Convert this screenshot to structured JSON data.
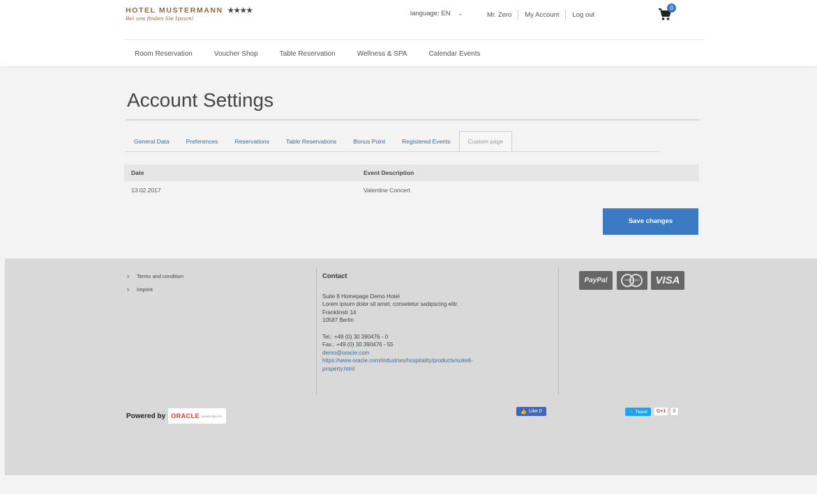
{
  "header": {
    "hotel_name": "HOTEL MUSTERMANN",
    "stars": "★★★★",
    "tagline": "Bei uns finden Sie Ipsum!",
    "language": "language: EN",
    "user_name": "Mr. Zero",
    "my_account": "My Account",
    "logout": "Log out",
    "cart_count": "0"
  },
  "nav": {
    "items": [
      "Room Reservation",
      "Voucher Shop",
      "Table Reservation",
      "Wellness & SPA",
      "Calendar Events"
    ]
  },
  "page": {
    "title": "Account Settings",
    "tabs": [
      "General Data",
      "Preferences",
      "Reservations",
      "Table Reservations",
      "Bonus Point",
      "Registered Events",
      "Custom page"
    ],
    "active_tab": "Custom page"
  },
  "table": {
    "headers": [
      "Date",
      "Event Description"
    ],
    "rows": [
      [
        "13.02.2017",
        "Valentine Concert"
      ]
    ]
  },
  "actions": {
    "save_label": "Save changes"
  },
  "footer": {
    "links": [
      "Terms and condition",
      "Imprint"
    ],
    "contact_heading": "Contact",
    "contact_lines": [
      "Suite 8 Homepage Demo Hotel",
      "Lorem ipsum dolor sit amet, consetetur sadipscing elitr.",
      "Franklinstr 14",
      "10587 Berlin"
    ],
    "tel": "Tel.: +49 (0) 30 390476 - 0",
    "fax": "Fax.: +49 (0) 30 390476 - 55",
    "email": "demo@oracle.com",
    "url_line1": "https://www.oracle.com/industries/hospitality/products/suite8-",
    "url_line2": "property.html",
    "payment": {
      "paypal": "PayPal",
      "mastercard": "MasterCard",
      "visa": "VISA"
    },
    "powered_by": "Powered by",
    "oracle": "ORACLE",
    "oracle_sub": "HOSPITALITY",
    "fb_like": "Like 0",
    "tweet": "Tweet",
    "gplus": "G+1",
    "gplus_count": "0"
  }
}
